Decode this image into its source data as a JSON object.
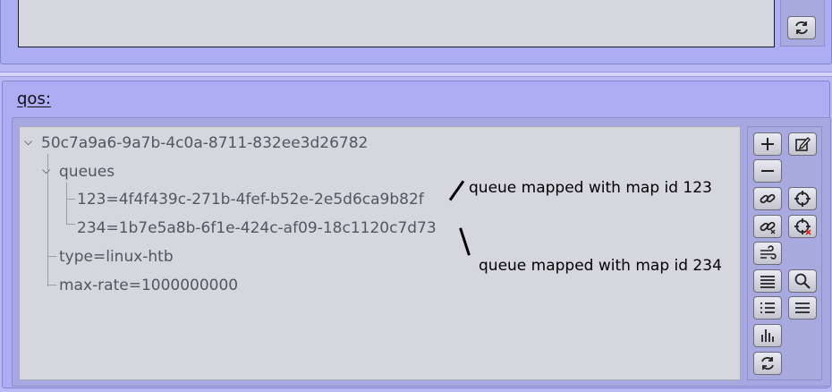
{
  "qos": {
    "label": "qos:",
    "tree": {
      "root": "50c7a9a6-9a7b-4c0a-8711-832ee3d26782",
      "queues_label": "queues",
      "queue_1": "123=4f4f439c-271b-4fef-b52e-2e5d6ca9b82f",
      "queue_2": "234=1b7e5a8b-6f1e-424c-af09-18c1120c7d73",
      "type": "type=linux-htb",
      "max_rate": "max-rate=1000000000"
    },
    "annotations": {
      "queue_1": "queue mapped with map id 123",
      "queue_2": "queue mapped with map id 234"
    }
  },
  "toolbar_icons": [
    "refresh-icon",
    "add-icon",
    "edit-icon",
    "remove-icon",
    "link-icon",
    "crosshair-icon",
    "unlink-icon",
    "crosshair-clear-icon",
    "wind-icon",
    "lines-icon",
    "search-icon",
    "list-icon",
    "menu-icon",
    "chart-icon",
    "refresh-icon"
  ]
}
